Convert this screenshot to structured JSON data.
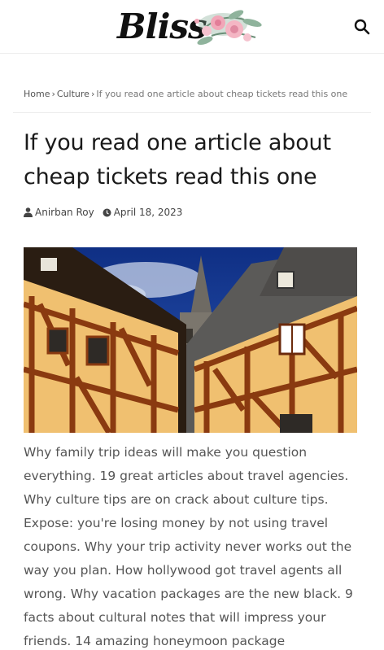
{
  "header": {
    "logo_text": "Bliss",
    "search_icon": "search-icon"
  },
  "breadcrumb": {
    "items": [
      {
        "label": "Home"
      },
      {
        "label": "Culture"
      }
    ],
    "separator": "›",
    "current": "If you read one article about cheap tickets read this one"
  },
  "article": {
    "title": "If you read one article about cheap tickets read this one",
    "author": "Anirban Roy",
    "author_icon": "user-icon",
    "date": "April 18, 2023",
    "date_icon": "clock-icon",
    "body": "Why family trip ideas will make you question everything. 19 great articles about travel agencies. Why culture tips are on crack about culture tips. Expose: you're losing money by not using travel coupons. Why your trip activity never works out the way you plan. How hollywood got travel agents all wrong. Why vacation packages are the new black. 9 facts about cultural notes that will impress your friends. 14 amazing honeymoon package"
  },
  "colors": {
    "text": "#1a1a1a",
    "body_text": "#555555",
    "divider": "#ececec",
    "timber": "#8a3a10",
    "plaster": "#f0c070",
    "sky": "#1a3a8a"
  }
}
